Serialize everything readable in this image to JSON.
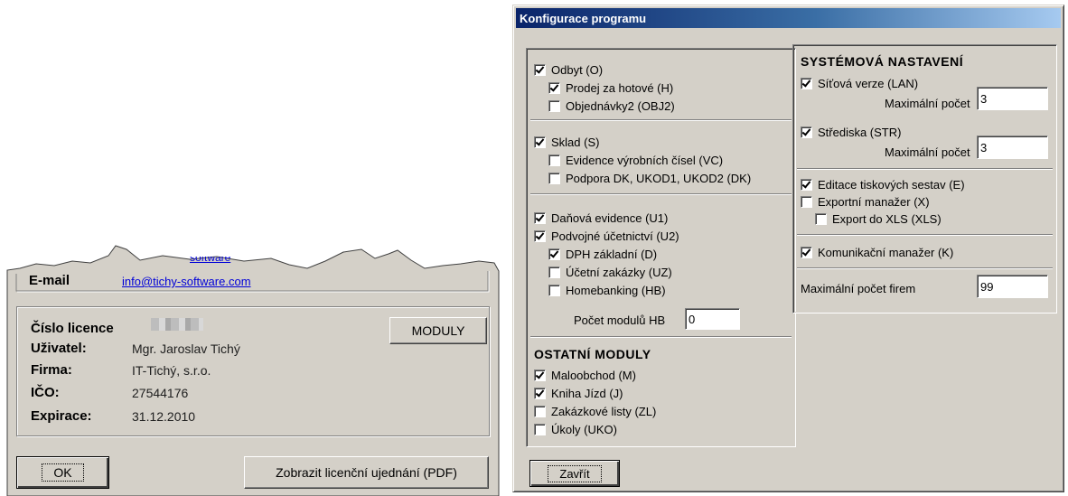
{
  "about": {
    "email_label": "E-mail",
    "email_value": "info@tichy-software.com",
    "partial_link": "software",
    "license": {
      "license_number_label": "Číslo licence",
      "user_label": "Uživatel:",
      "user_value": "Mgr. Jaroslav Tichý",
      "company_label": "Firma:",
      "company_value": "IT-Tichý, s.r.o.",
      "ico_label": "IČO:",
      "ico_value": "27544176",
      "expiry_label": "Expirace:",
      "expiry_value": "31.12.2010",
      "modules_button": "MODULY"
    },
    "ok_button": "OK",
    "license_agreement_button": "Zobrazit licenční ujednání (PDF)"
  },
  "config": {
    "title": "Konfigurace programu",
    "close_button": "Zavřít",
    "group_sales": [
      {
        "label": "Odbyt (O)",
        "checked": true,
        "level": 0
      },
      {
        "label": "Prodej za hotové (H)",
        "checked": true,
        "level": 1
      },
      {
        "label": "Objednávky2 (OBJ2)",
        "checked": false,
        "level": 1
      }
    ],
    "group_stock": [
      {
        "label": "Sklad (S)",
        "checked": true,
        "level": 0
      },
      {
        "label": "Evidence výrobních čísel (VC)",
        "checked": false,
        "level": 1
      },
      {
        "label": "Podpora DK, UKOD1, UKOD2 (DK)",
        "checked": false,
        "level": 1
      }
    ],
    "group_accounting": [
      {
        "label": "Daňová evidence (U1)",
        "checked": true,
        "level": 0
      },
      {
        "label": "Podvojné účetnictví (U2)",
        "checked": true,
        "level": 0
      },
      {
        "label": "DPH základní (D)",
        "checked": true,
        "level": 1
      },
      {
        "label": "Účetní zakázky (UZ)",
        "checked": false,
        "level": 1
      },
      {
        "label": "Homebanking (HB)",
        "checked": false,
        "level": 1
      }
    ],
    "hb_count_label": "Počet modulů HB",
    "hb_count_value": "0",
    "other_modules_heading": "OSTATNÍ MODULY",
    "other_modules": [
      {
        "label": "Maloobchod (M)",
        "checked": true
      },
      {
        "label": "Kniha Jízd (J)",
        "checked": true
      },
      {
        "label": "Zakázkové listy (ZL)",
        "checked": false
      },
      {
        "label": "Úkoly (UKO)",
        "checked": false
      }
    ],
    "system_heading": "SYSTÉMOVÁ NASTAVENÍ",
    "network": {
      "label": "Síťová verze (LAN)",
      "checked": true,
      "max_label": "Maximální počet",
      "max_value": "3"
    },
    "centers": {
      "label": "Střediska (STR)",
      "checked": true,
      "max_label": "Maximální počet",
      "max_value": "3"
    },
    "print_edit": {
      "label": "Editace tiskových sestav (E)",
      "checked": true
    },
    "export_manager": {
      "label": "Exportní manažer (X)",
      "checked": false
    },
    "export_xls": {
      "label": "Export do XLS (XLS)",
      "checked": false
    },
    "comm_manager": {
      "label": "Komunikační manažer (K)",
      "checked": true
    },
    "max_companies_label": "Maximální počet firem",
    "max_companies_value": "99"
  }
}
